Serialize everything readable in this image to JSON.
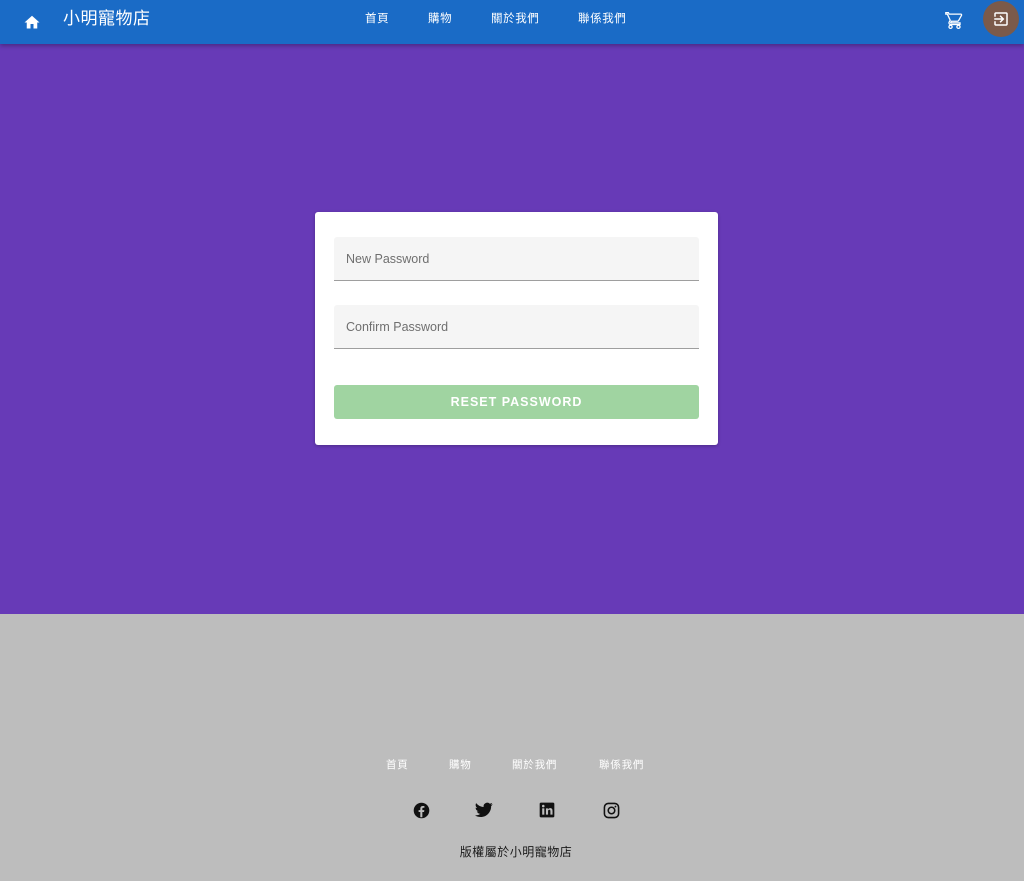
{
  "header": {
    "brand": "小明寵物店",
    "nav": [
      {
        "label": "首頁",
        "name": "nav-home"
      },
      {
        "label": "購物",
        "name": "nav-shop"
      },
      {
        "label": "關於我們",
        "name": "nav-about"
      },
      {
        "label": "聯係我們",
        "name": "nav-contact"
      }
    ],
    "icons": {
      "home": "home-icon",
      "cart": "shopping-cart-icon",
      "login": "login-icon"
    },
    "colors": {
      "bar": "#1a6bc6",
      "login_button": "#7b5a4a"
    }
  },
  "main": {
    "background": "#673ab7",
    "form": {
      "new_password": {
        "placeholder": "New Password",
        "value": ""
      },
      "confirm_password": {
        "placeholder": "Confirm Password",
        "value": ""
      },
      "submit_label": "RESET PASSWORD",
      "submit_color": "#a0d4a1"
    }
  },
  "footer": {
    "links": [
      {
        "label": "首頁"
      },
      {
        "label": "購物"
      },
      {
        "label": "關於我們"
      },
      {
        "label": "聯係我們"
      }
    ],
    "social": [
      "facebook-icon",
      "twitter-icon",
      "linkedin-icon",
      "instagram-icon"
    ],
    "copyright": "版權屬於小明寵物店",
    "background": "#bdbdbd"
  }
}
